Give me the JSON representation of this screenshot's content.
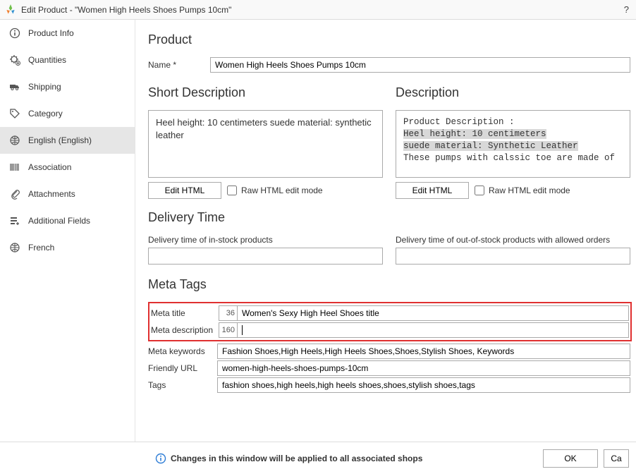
{
  "window": {
    "title": "Edit Product - \"Women High Heels Shoes Pumps 10cm\"",
    "help": "?"
  },
  "sidebar": {
    "items": [
      {
        "label": "Product Info"
      },
      {
        "label": "Quantities"
      },
      {
        "label": "Shipping"
      },
      {
        "label": "Category"
      },
      {
        "label": "English (English)"
      },
      {
        "label": "Association"
      },
      {
        "label": "Attachments"
      },
      {
        "label": "Additional Fields"
      },
      {
        "label": "French"
      }
    ]
  },
  "product": {
    "section_title": "Product",
    "name_label": "Name *",
    "name_value": "Women High Heels Shoes Pumps 10cm"
  },
  "short_desc": {
    "title": "Short Description",
    "text": "Heel height: 10 centimeters suede material: synthetic leather",
    "edit_html": "Edit HTML",
    "raw_label": "Raw HTML edit mode"
  },
  "desc": {
    "title": "Description",
    "line1": "Product Description :",
    "line2": "Heel height: 10 centimeters",
    "line3": "suede material: Synthetic Leather",
    "line4": "These pumps with calssic toe are made of",
    "edit_html": "Edit HTML",
    "raw_label": "Raw HTML edit mode"
  },
  "delivery": {
    "title": "Delivery Time",
    "in_stock_label": "Delivery time of in-stock products",
    "in_stock_value": "",
    "out_stock_label": "Delivery time of out-of-stock products with allowed orders",
    "out_stock_value": ""
  },
  "meta": {
    "title": "Meta Tags",
    "meta_title_label": "Meta title",
    "meta_title_count": "36",
    "meta_title_value": "Women's Sexy High Heel Shoes title",
    "meta_desc_label": "Meta description",
    "meta_desc_count": "160",
    "meta_desc_value": "",
    "keywords_label": "Meta keywords",
    "keywords_value": "Fashion Shoes,High Heels,High Heels Shoes,Shoes,Stylish Shoes, Keywords",
    "friendly_label": "Friendly URL",
    "friendly_value": "women-high-heels-shoes-pumps-10cm",
    "tags_label": "Tags",
    "tags_value": "fashion shoes,high heels,high heels shoes,shoes,stylish shoes,tags"
  },
  "footer": {
    "message": "Changes in this window will be applied to all associated shops",
    "ok": "OK",
    "cancel": "Ca"
  }
}
